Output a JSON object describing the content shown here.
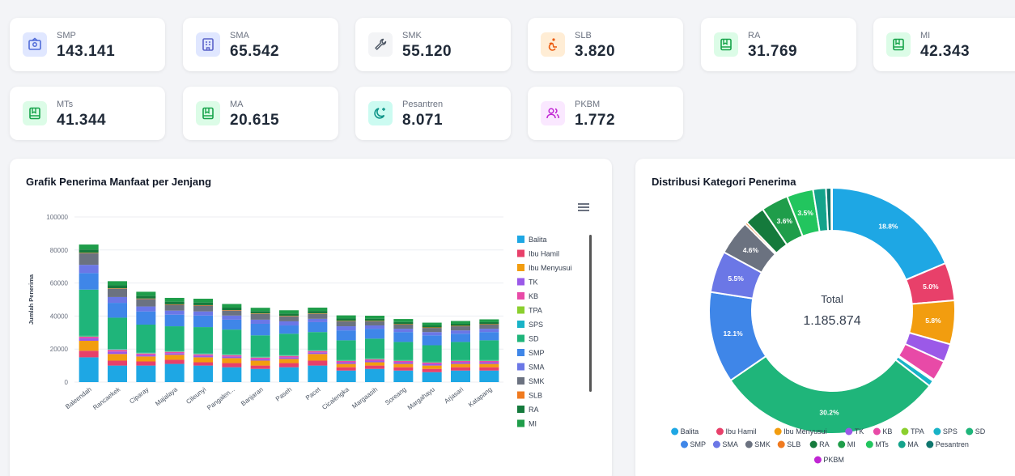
{
  "stats": [
    {
      "label": "SMP",
      "value": "143.141",
      "icon": "school-icon",
      "icon_bg": "#e0e7ff",
      "icon_color": "#4f6bd8"
    },
    {
      "label": "SMA",
      "value": "65.542",
      "icon": "building-icon",
      "icon_bg": "#e0e7ff",
      "icon_color": "#5b63c9"
    },
    {
      "label": "SMK",
      "value": "55.120",
      "icon": "wrench-icon",
      "icon_bg": "#f3f4f6",
      "icon_color": "#4b5563"
    },
    {
      "label": "SLB",
      "value": "3.820",
      "icon": "accessibility-icon",
      "icon_bg": "#ffedd5",
      "icon_color": "#ea580c"
    },
    {
      "label": "RA",
      "value": "31.769",
      "icon": "book-icon",
      "icon_bg": "#dcfce7",
      "icon_color": "#16a34a"
    },
    {
      "label": "MI",
      "value": "42.343",
      "icon": "book-icon",
      "icon_bg": "#dcfce7",
      "icon_color": "#16a34a"
    },
    {
      "label": "MTs",
      "value": "41.344",
      "icon": "book-icon",
      "icon_bg": "#dcfce7",
      "icon_color": "#16a34a"
    },
    {
      "label": "MA",
      "value": "20.615",
      "icon": "book-icon",
      "icon_bg": "#dcfce7",
      "icon_color": "#16a34a"
    },
    {
      "label": "Pesantren",
      "value": "8.071",
      "icon": "moon-icon",
      "icon_bg": "#ccfbf1",
      "icon_color": "#0d9488"
    },
    {
      "label": "PKBM",
      "value": "1.772",
      "icon": "users-icon",
      "icon_bg": "#fae8ff",
      "icon_color": "#c026d3"
    }
  ],
  "bar_panel": {
    "title": "Grafik Penerima Manfaat per Jenjang",
    "menu_icon": "hamburger-icon"
  },
  "donut_panel": {
    "title": "Distribusi Kategori Penerima",
    "center_label": "Total",
    "center_value": "1.185.874"
  },
  "chart_data": [
    {
      "type": "bar",
      "stacked": true,
      "title": "Grafik Penerima Manfaat per Jenjang",
      "ylabel": "Jumlah Penerima",
      "xlabel": "",
      "ylim": [
        0,
        100000
      ],
      "yticks": [
        "0",
        "20000",
        "40000",
        "60000",
        "80000",
        "100000"
      ],
      "grid": true,
      "legend_position": "right",
      "categories": [
        "Baleendah",
        "Rancaekek",
        "Ciparay",
        "Majalaya",
        "Cileunyi",
        "Pangalen...",
        "Banjaran",
        "Paseh",
        "Pacet",
        "Cicalengka",
        "Margaasih",
        "Soreang",
        "Margahayu",
        "Arjasari",
        "Katapang"
      ],
      "series": [
        {
          "name": "Balita",
          "color": "#1ea7e4",
          "values": [
            15000,
            10000,
            10000,
            11000,
            10000,
            9000,
            8000,
            9000,
            10000,
            7000,
            8000,
            7000,
            6000,
            7000,
            7000
          ]
        },
        {
          "name": "Ibu Hamil",
          "color": "#e8406a",
          "values": [
            4000,
            3000,
            2500,
            2500,
            2000,
            2500,
            2000,
            2500,
            3000,
            2000,
            2000,
            2000,
            2000,
            2000,
            2000
          ]
        },
        {
          "name": "Ibu Menyusui",
          "color": "#f29d0f",
          "values": [
            6000,
            4000,
            3000,
            3000,
            3000,
            3000,
            3000,
            2500,
            4000,
            2000,
            2000,
            2000,
            2000,
            2000,
            2000
          ]
        },
        {
          "name": "TK",
          "color": "#9b59e8",
          "values": [
            1500,
            1500,
            1000,
            1000,
            1000,
            1000,
            1000,
            1000,
            1000,
            1000,
            1000,
            1000,
            1000,
            1000,
            1000
          ]
        },
        {
          "name": "KB",
          "color": "#e84aa7",
          "values": [
            1000,
            1000,
            800,
            800,
            800,
            800,
            800,
            800,
            800,
            800,
            800,
            800,
            800,
            800,
            800
          ]
        },
        {
          "name": "TPA",
          "color": "#8bcf2e",
          "values": [
            200,
            200,
            200,
            200,
            200,
            200,
            200,
            200,
            200,
            200,
            200,
            200,
            200,
            200,
            200
          ]
        },
        {
          "name": "SPS",
          "color": "#18b3c7",
          "values": [
            300,
            300,
            300,
            300,
            300,
            300,
            300,
            300,
            300,
            300,
            300,
            300,
            300,
            300,
            300
          ]
        },
        {
          "name": "SD",
          "color": "#1fb57a",
          "values": [
            28000,
            19000,
            17000,
            15000,
            16000,
            15000,
            13000,
            13000,
            11000,
            12000,
            12000,
            11000,
            10000,
            11000,
            12000
          ]
        },
        {
          "name": "SMP",
          "color": "#3f86e8",
          "values": [
            10000,
            9000,
            8000,
            7000,
            7000,
            6000,
            7000,
            5000,
            6000,
            6000,
            6000,
            6000,
            6000,
            5000,
            5000
          ]
        },
        {
          "name": "SMA",
          "color": "#6b77e6",
          "values": [
            5000,
            3500,
            3000,
            2500,
            2500,
            2500,
            2500,
            2500,
            2000,
            2500,
            2000,
            2000,
            2000,
            2000,
            2000
          ]
        },
        {
          "name": "SMK",
          "color": "#6b7280",
          "values": [
            7000,
            5000,
            4500,
            3500,
            3500,
            3000,
            3500,
            3000,
            3000,
            3000,
            2500,
            2500,
            2500,
            2500,
            2500
          ]
        },
        {
          "name": "SLB",
          "color": "#f07a1f",
          "values": [
            300,
            300,
            300,
            300,
            300,
            300,
            300,
            300,
            300,
            300,
            300,
            300,
            300,
            300,
            300
          ]
        },
        {
          "name": "RA",
          "color": "#157a3c",
          "values": [
            2000,
            1800,
            1700,
            1600,
            1600,
            1500,
            1400,
            1400,
            1500,
            1400,
            1300,
            1300,
            1200,
            1200,
            1200
          ]
        },
        {
          "name": "MI",
          "color": "#1f9d4a",
          "values": [
            3000,
            2500,
            2400,
            2300,
            2300,
            2200,
            2000,
            2000,
            2000,
            1900,
            1800,
            1800,
            1700,
            1700,
            1700
          ]
        }
      ]
    },
    {
      "type": "pie",
      "donut": true,
      "title": "Distribusi Kategori Penerima",
      "legend_position": "bottom",
      "labels": [
        "Balita",
        "Ibu Hamil",
        "Ibu Menyusui",
        "TK",
        "KB",
        "TPA",
        "SPS",
        "SD",
        "SMP",
        "SMA",
        "SMK",
        "SLB",
        "RA",
        "MI",
        "MTs",
        "MA",
        "Pesantren",
        "PKBM"
      ],
      "colors": [
        "#1ea7e4",
        "#e8406a",
        "#f29d0f",
        "#9b59e8",
        "#e84aa7",
        "#8bcf2e",
        "#18b3c7",
        "#1fb57a",
        "#3f86e8",
        "#6b77e6",
        "#6b7280",
        "#f07a1f",
        "#157a3c",
        "#1f9d4a",
        "#22c55e",
        "#14a38b",
        "#0f766e",
        "#c026d3"
      ],
      "values": [
        18.8,
        5.0,
        5.8,
        2.4,
        2.7,
        0.2,
        0.8,
        30.2,
        12.1,
        5.5,
        4.6,
        0.3,
        2.7,
        3.6,
        3.5,
        1.7,
        0.7,
        0.1
      ],
      "value_labels": [
        "18.8%",
        "5.0%",
        "5.8%",
        "",
        "",
        "",
        "",
        "30.2%",
        "12.1%",
        "5.5%",
        "4.6%",
        "",
        "",
        "3.6%",
        "3.5%",
        "",
        "",
        ""
      ]
    }
  ]
}
